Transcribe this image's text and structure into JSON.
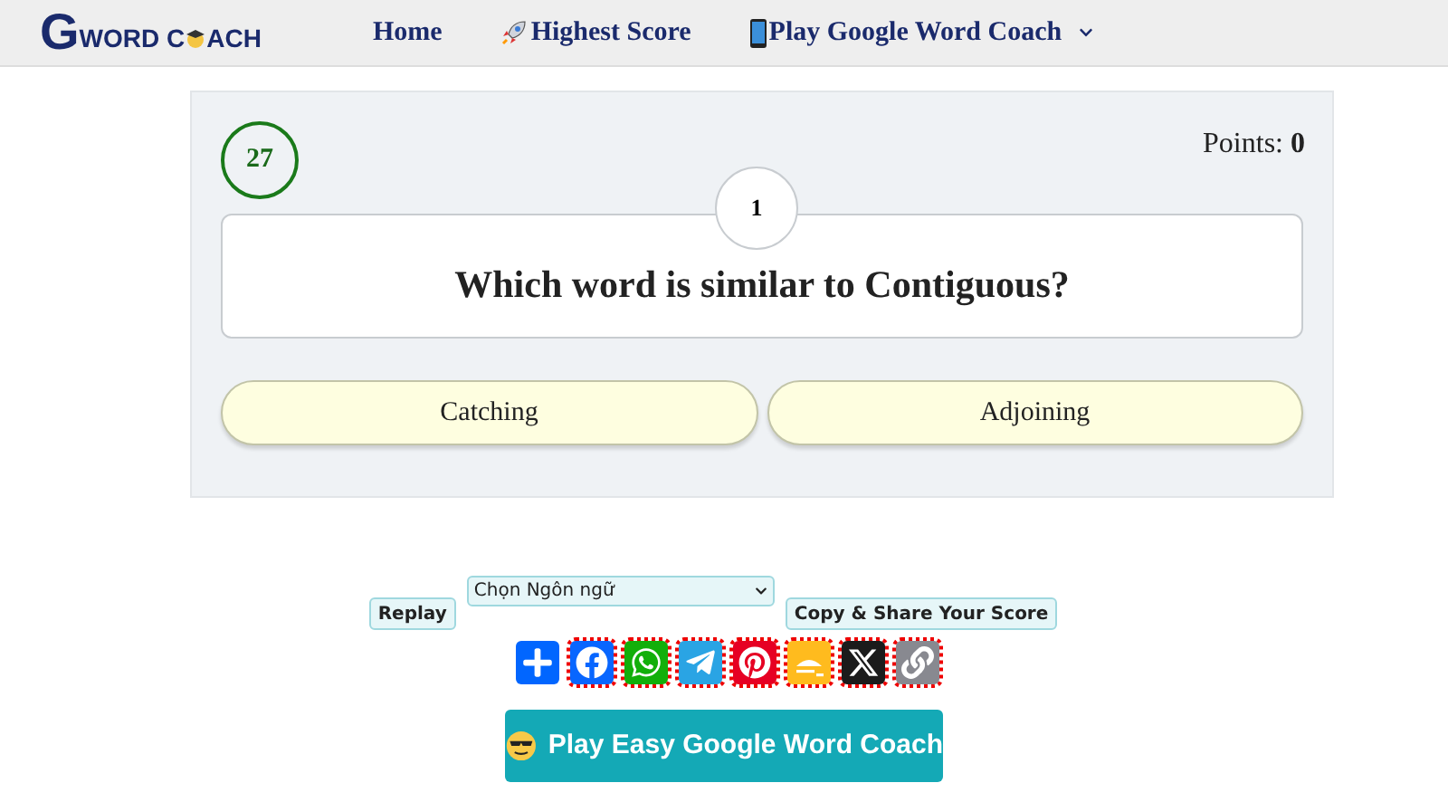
{
  "logo": {
    "initial": "G",
    "text_before": "WORD C",
    "text_after": "ACH"
  },
  "nav": [
    {
      "label": "Home",
      "kind": "plain",
      "dropdown": false
    },
    {
      "label": "Highest Score",
      "kind": "rocket",
      "dropdown": false
    },
    {
      "label": "Play Google Word Coach",
      "kind": "phone",
      "dropdown": true
    }
  ],
  "quiz": {
    "timer": "27",
    "points_label": "Points:",
    "points": "0",
    "question_number": "1",
    "question": "Which word is similar to Contiguous?",
    "answers": [
      {
        "label": "Catching"
      },
      {
        "label": "Adjoining"
      }
    ]
  },
  "controls": {
    "replay": "Replay",
    "language_select": {
      "value": "Chọn Ngôn ngữ"
    },
    "copy_share": "Copy & Share Your Score"
  },
  "share_buttons": [
    {
      "kind": "plus",
      "color": "#0166ff"
    },
    {
      "kind": "facebook",
      "color": "#0866ff"
    },
    {
      "kind": "whatsapp",
      "color": "#12af0a"
    },
    {
      "kind": "telegram",
      "color": "#2aa4e4"
    },
    {
      "kind": "pinterest",
      "color": "#e60023"
    },
    {
      "kind": "meetup",
      "color": "#ffbb1e"
    },
    {
      "kind": "x",
      "color": "#1b1b1b"
    },
    {
      "kind": "link",
      "color": "#888990"
    }
  ],
  "play_button": {
    "label": "Play Easy Google Word Coach"
  }
}
